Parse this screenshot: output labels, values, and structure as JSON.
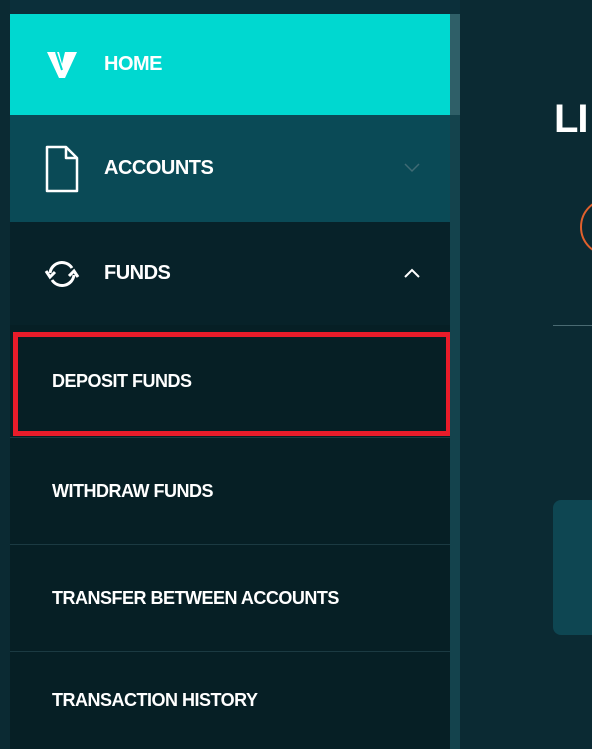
{
  "sidebar": {
    "home": {
      "label": "HOME",
      "icon": "brand-v-logo-icon"
    },
    "accounts": {
      "label": "ACCOUNTS",
      "icon": "document-icon",
      "chevron": "chevron-down-icon"
    },
    "funds": {
      "label": "FUNDS",
      "icon": "refresh-arrows-icon",
      "chevron": "chevron-up-icon",
      "items": [
        {
          "label": "DEPOSIT FUNDS"
        },
        {
          "label": "WITHDRAW FUNDS"
        },
        {
          "label": "TRANSFER BETWEEN ACCOUNTS"
        },
        {
          "label": "TRANSACTION HISTORY"
        }
      ]
    }
  },
  "main": {
    "title": "LI"
  },
  "colors": {
    "accent_cyan": "#00d8d0",
    "highlight_red": "#e81c2a",
    "background": "#0b2a33",
    "ring_orange": "#e0602c"
  }
}
